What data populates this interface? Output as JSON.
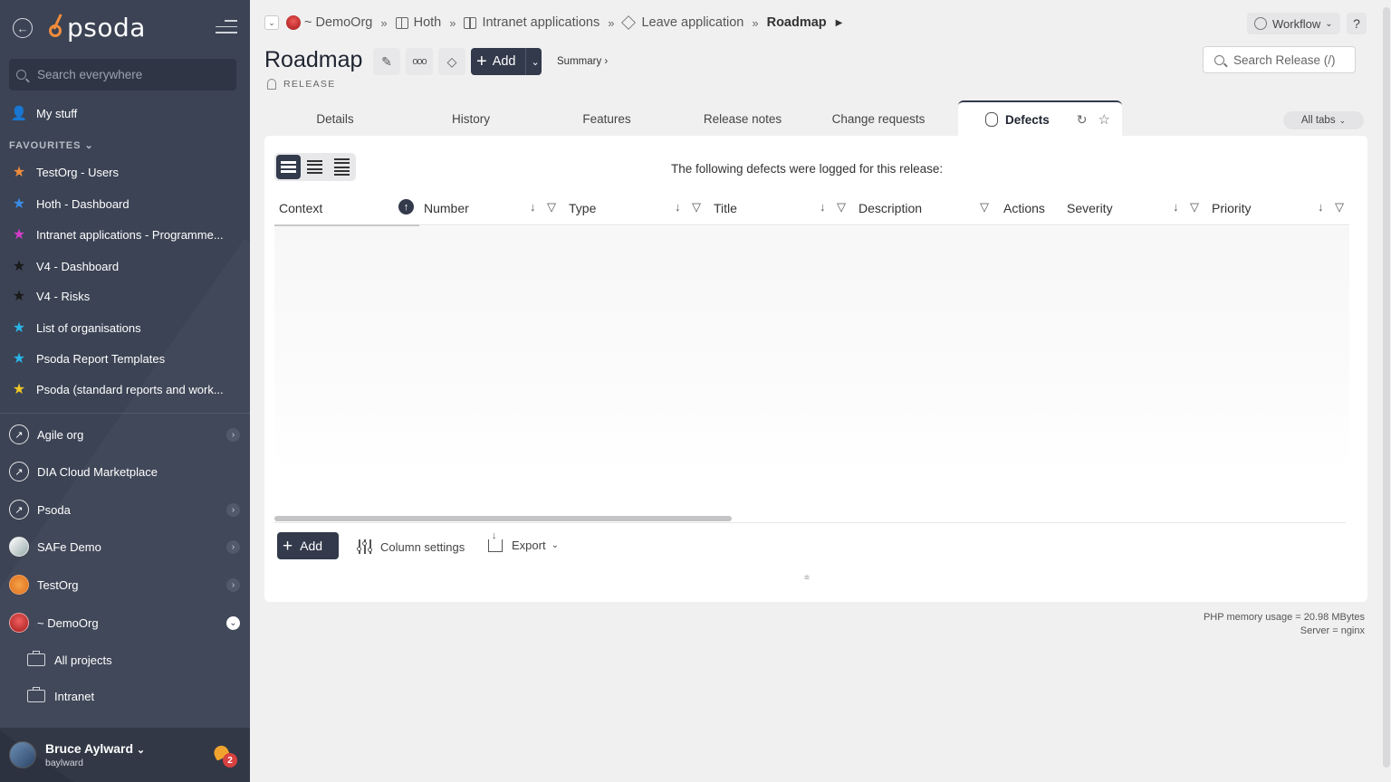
{
  "sidebar": {
    "brand": "psoda",
    "search_placeholder": "Search everywhere",
    "my_stuff": "My stuff",
    "favourites_label": "FAVOURITES",
    "favourites": [
      {
        "label": "TestOrg - Users",
        "color": "#f08c3c"
      },
      {
        "label": "Hoth - Dashboard",
        "color": "#3c8ce6"
      },
      {
        "label": "Intranet applications - Programme...",
        "color": "#d23cc8"
      },
      {
        "label": "V4 - Dashboard",
        "color": "#2a2a2a"
      },
      {
        "label": "V4 - Risks",
        "color": "#2a2a2a"
      },
      {
        "label": "List of organisations",
        "color": "#2ab4e6"
      },
      {
        "label": "Psoda Report Templates",
        "color": "#2ab4e6"
      },
      {
        "label": "Psoda (standard reports and work...",
        "color": "#f0c828"
      }
    ],
    "orgs": [
      {
        "label": "Agile org",
        "expandable": true
      },
      {
        "label": "DIA Cloud Marketplace",
        "expandable": false
      },
      {
        "label": "Psoda",
        "expandable": true
      },
      {
        "label": "SAFe Demo",
        "expandable": true
      },
      {
        "label": "TestOrg",
        "expandable": true
      },
      {
        "label": "~ DemoOrg",
        "expandable": true,
        "open": true
      }
    ],
    "sub_items": [
      "All projects",
      "Intranet"
    ],
    "user": {
      "name": "Bruce Aylward",
      "login": "baylward",
      "notifications": "2"
    }
  },
  "breadcrumb": {
    "items": [
      "~ DemoOrg",
      "Hoth",
      "Intranet applications",
      "Leave application"
    ],
    "current": "Roadmap"
  },
  "header": {
    "workflow_label": "Workflow",
    "help_label": "?",
    "title": "Roadmap",
    "type_label": "RELEASE",
    "add_label": "Add",
    "summary_label": "Summary ›",
    "search_placeholder": "Search Release (/)"
  },
  "tabs": [
    {
      "label": "Details"
    },
    {
      "label": "History"
    },
    {
      "label": "Features"
    },
    {
      "label": "Release notes"
    },
    {
      "label": "Change requests"
    },
    {
      "label": "Defects",
      "active": true
    }
  ],
  "all_tabs_label": "All tabs",
  "table": {
    "info": "The following defects were logged for this release:",
    "columns": [
      "Context",
      "Number",
      "Type",
      "Title",
      "Description",
      "Actions",
      "Severity",
      "Priority"
    ],
    "rows": []
  },
  "footer": {
    "add_label": "Add",
    "column_settings_label": "Column settings",
    "export_label": "Export"
  },
  "server_info": {
    "memory": "PHP memory usage = 20.98 MBytes",
    "server": "Server = nginx"
  },
  "colors": {
    "sidebar_bg": "#3b4354",
    "primary_button": "#323a4b",
    "accent": "#f08c3c"
  }
}
